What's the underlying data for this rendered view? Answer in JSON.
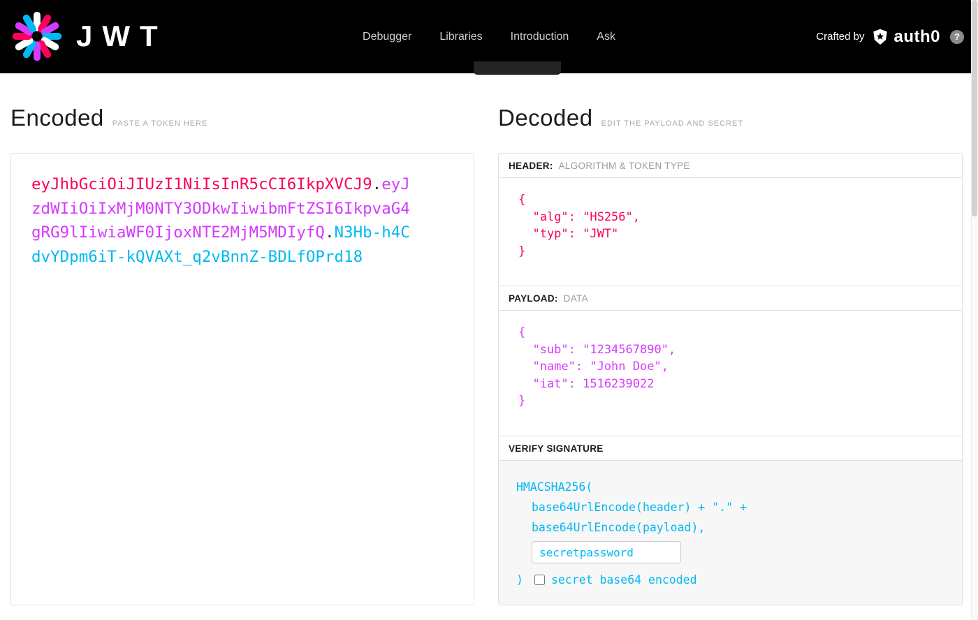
{
  "colors": {
    "header": "#fb015b",
    "payload": "#d63aff",
    "signature": "#00b9f1"
  },
  "navbar": {
    "logo": "JWT",
    "links": [
      {
        "label": "Debugger"
      },
      {
        "label": "Libraries"
      },
      {
        "label": "Introduction"
      },
      {
        "label": "Ask"
      }
    ],
    "crafted_by": "Crafted by",
    "auth0_label": "auth0",
    "help": "?"
  },
  "encoded": {
    "title": "Encoded",
    "subtitle": "PASTE A TOKEN HERE",
    "token": {
      "header": "eyJhbGciOiJIUzI1NiIsInR5cCI6IkpXVCJ9",
      "dot": ".",
      "payload": "eyJzdWIiOiIxMjM0NTY3ODkwIiwibmFtZSI6IkpvaG4gRG9lIiwiaWF0IjoxNTE2MjM5MDIyfQ",
      "signature": "N3Hb-h4CdvYDpm6iT-kQVAXt_q2vBnnZ-BDLfOPrd18"
    }
  },
  "decoded": {
    "title": "Decoded",
    "subtitle": "EDIT THE PAYLOAD AND SECRET",
    "header_section": {
      "label": "HEADER:",
      "sublabel": "ALGORITHM & TOKEN TYPE",
      "json": "{\n  \"alg\": \"HS256\",\n  \"typ\": \"JWT\"\n}"
    },
    "payload_section": {
      "label": "PAYLOAD:",
      "sublabel": "DATA",
      "json": "{\n  \"sub\": \"1234567890\",\n  \"name\": \"John Doe\",\n  \"iat\": 1516239022\n}"
    },
    "signature_section": {
      "label": "VERIFY SIGNATURE",
      "lines": [
        "HMACSHA256(",
        "base64UrlEncode(header) + \".\" +",
        "base64UrlEncode(payload),"
      ],
      "secret_value": "secretpassword",
      "close_paren": ")",
      "checkbox_label": "secret base64 encoded"
    }
  }
}
